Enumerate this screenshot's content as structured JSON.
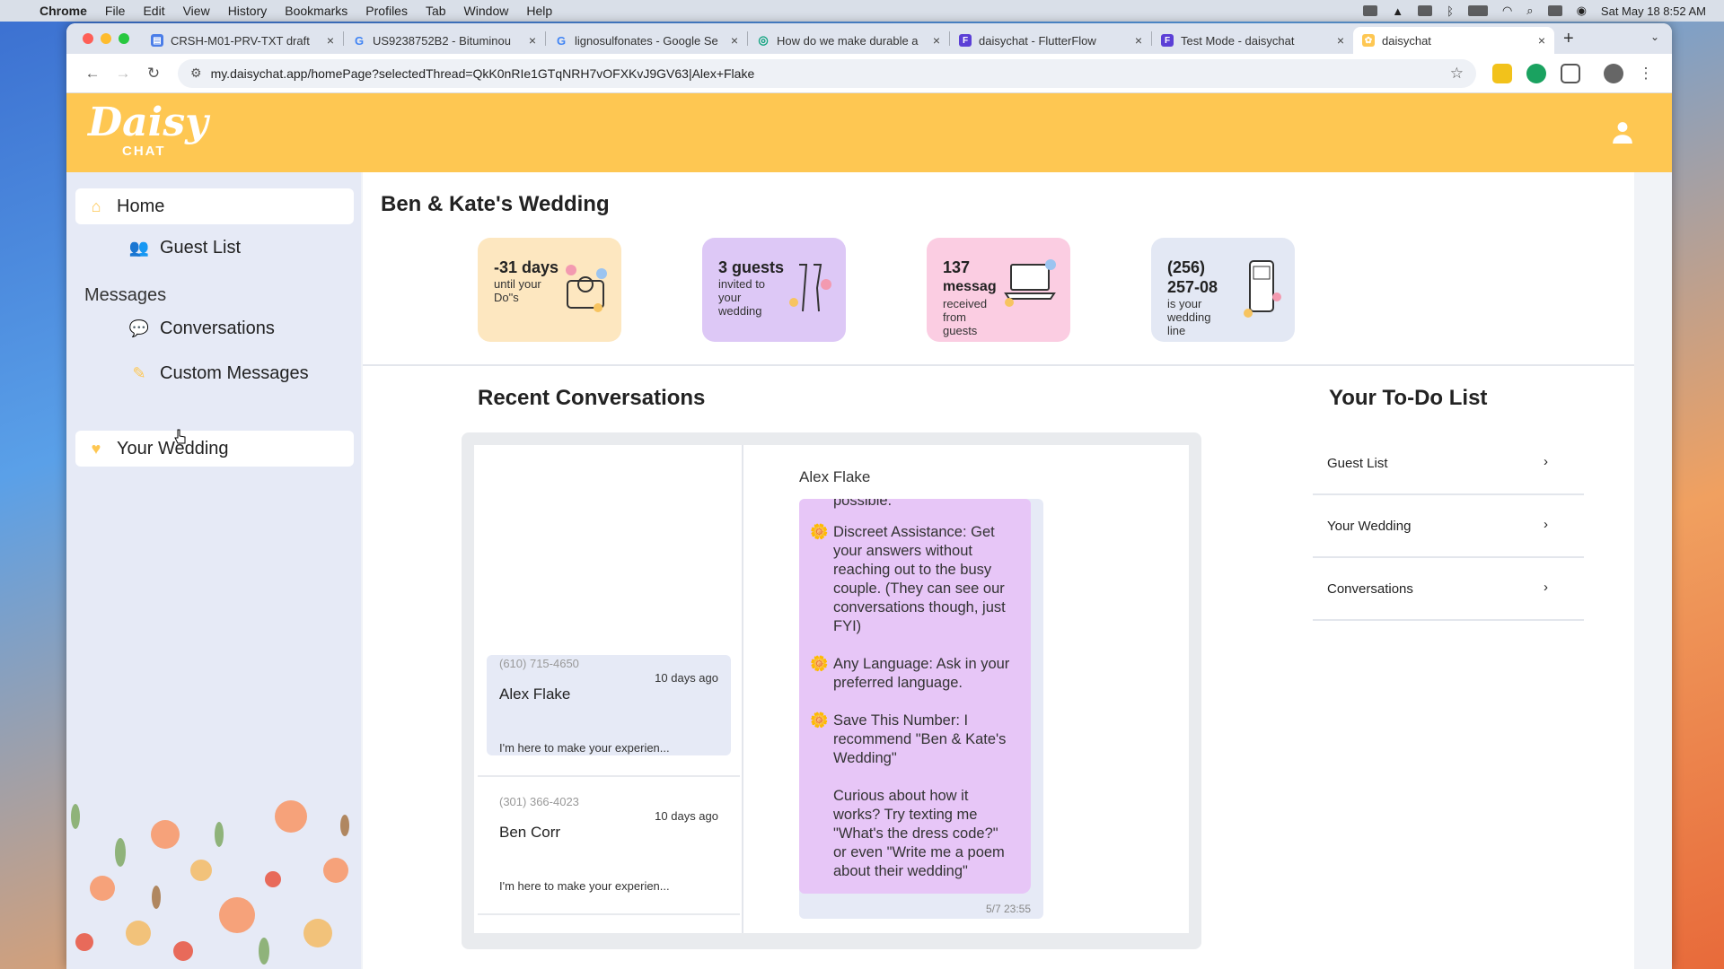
{
  "menubar": {
    "app": "Chrome",
    "items": [
      "File",
      "Edit",
      "View",
      "History",
      "Bookmarks",
      "Profiles",
      "Tab",
      "Window",
      "Help"
    ],
    "clock": "Sat May 18  8:52 AM"
  },
  "browser": {
    "tabs": [
      {
        "title": "CRSH-M01-PRV-TXT draft",
        "color": "#4a7de8",
        "glyph": "▤"
      },
      {
        "title": "US9238752B2 - Bituminou",
        "color": "#ffffff",
        "glyph": "G"
      },
      {
        "title": "lignosulfonates - Google Se",
        "color": "#ffffff",
        "glyph": "G"
      },
      {
        "title": "How do we make durable a",
        "color": "#ffffff",
        "glyph": "◎"
      },
      {
        "title": "daisychat - FlutterFlow",
        "color": "#5b3fd6",
        "glyph": "F"
      },
      {
        "title": "Test Mode - daisychat",
        "color": "#5b3fd6",
        "glyph": "F"
      },
      {
        "title": "daisychat",
        "color": "#fec752",
        "glyph": "✿"
      }
    ],
    "url": "my.daisychat.app/homePage?selectedThread=QkK0nRIe1GTqNRH7vOFXKvJ9GV63|Alex+Flake"
  },
  "app": {
    "logo_main": "Daisy",
    "logo_sub": "CHAT",
    "brand_color": "#fec752",
    "sidebar": {
      "home": "Home",
      "guest_list": "Guest List",
      "messages_heading": "Messages",
      "conversations": "Conversations",
      "custom_messages": "Custom Messages",
      "your_wedding": "Your Wedding"
    },
    "title": "Ben & Kate's Wedding",
    "stats": [
      {
        "big": "-31 days",
        "small": "until your Do\"s",
        "color": "#fde7c0"
      },
      {
        "big": "3 guests",
        "small": "invited to your wedding",
        "color": "#ddc8f6"
      },
      {
        "big": "137",
        "small_big": "messag",
        "small": "received from guests",
        "color": "#fbcde2"
      },
      {
        "big": "(256)",
        "big2": "257-08",
        "small": "is your wedding line",
        "color": "#e3e8f4"
      }
    ],
    "recent_title": "Recent Conversations",
    "threads": [
      {
        "phone": "(610) 715-4650",
        "ago": "10 days ago",
        "name": "Alex Flake",
        "preview": "I'm here to make your experien..."
      },
      {
        "phone": "(301) 366-4023",
        "ago": "10 days ago",
        "name": "Ben Corr",
        "preview": "I'm here to make your experien..."
      }
    ],
    "chat": {
      "name": "Alex Flake",
      "top_fragment": "possible.",
      "p1": "Discreet Assistance: Get your answers without reaching out to the busy couple. (They can see our conversations though, just FYI)",
      "p2": "Any Language: Ask in your preferred language.",
      "p3": "Save This Number: I recommend \"Ben & Kate's Wedding\"",
      "p4": "Curious about how it works? Try texting me \"What's the dress code?\" or even \"Write me a poem about their wedding\"",
      "time": "5/7 23:55"
    },
    "todo_title": "Your To-Do List",
    "todo": [
      "Guest List",
      "Your Wedding",
      "Conversations"
    ]
  }
}
